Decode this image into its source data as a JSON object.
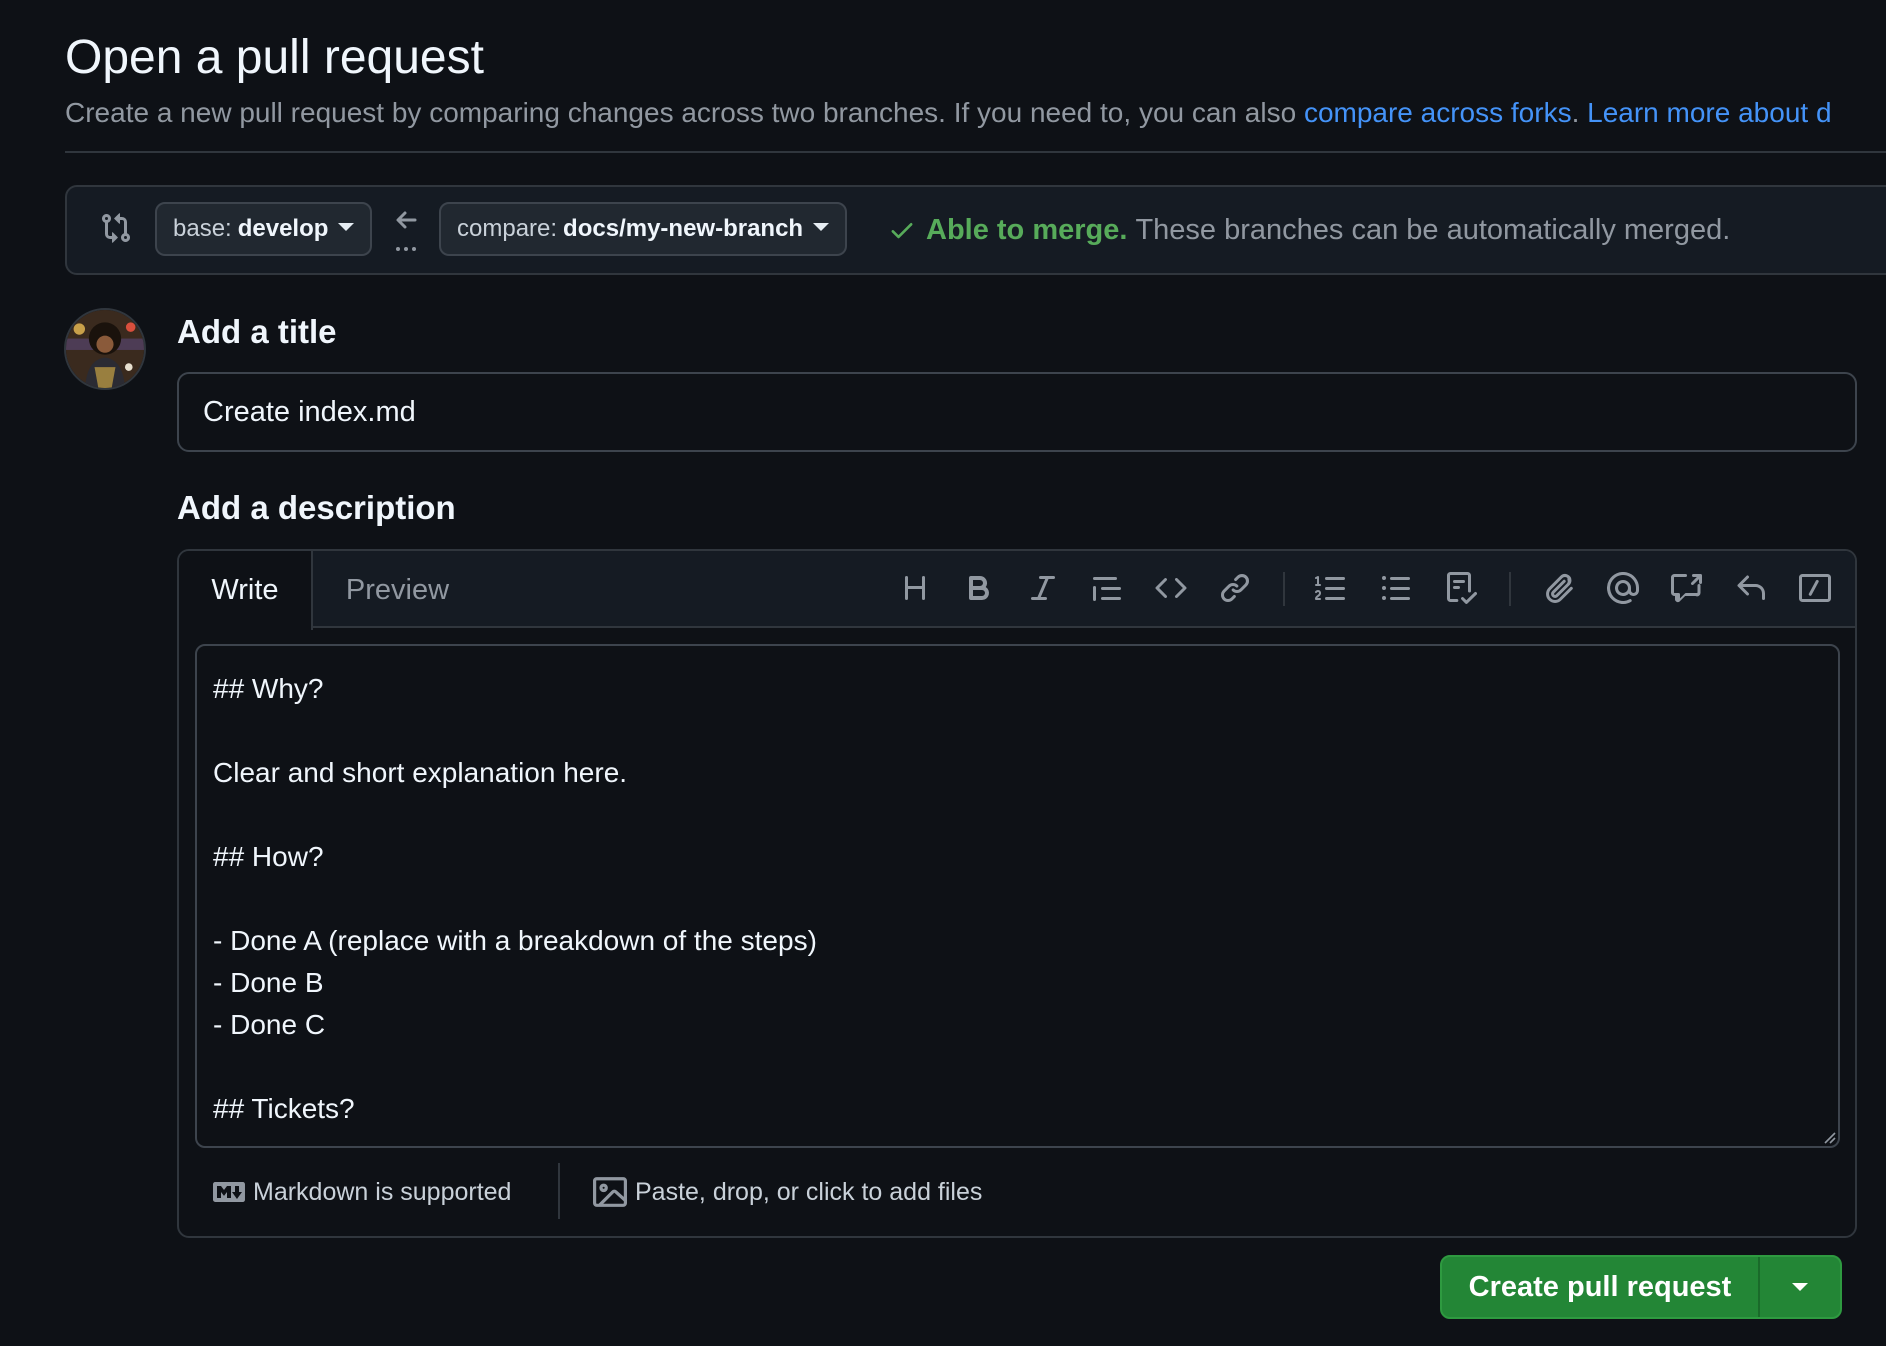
{
  "header": {
    "title": "Open a pull request",
    "subtitle": "Create a new pull request by comparing changes across two branches. If you need to, you can also ",
    "link_forks": "compare across forks",
    "link_sep": ". ",
    "link_learn": "Learn more about d"
  },
  "compare": {
    "base_prefix": "base:",
    "base_branch": "develop",
    "compare_prefix": "compare:",
    "compare_branch": "docs/my-new-branch",
    "merge_ok": "Able to merge.",
    "merge_desc": "These branches can be automatically merged."
  },
  "form": {
    "title_label": "Add a title",
    "title_value": "Create index.md",
    "description_label": "Add a description",
    "tabs": {
      "write": "Write",
      "preview": "Preview"
    },
    "body": "## Why?\n\nClear and short explanation here.\n\n## How?\n\n- Done A (replace with a breakdown of the steps)\n- Done B\n- Done C\n\n## Tickets?",
    "markdown_note": "Markdown is supported",
    "attach_note": "Paste, drop, or click to add files"
  },
  "toolbar": {
    "icons": [
      "heading-icon",
      "bold-icon",
      "italic-icon",
      "quote-icon",
      "code-icon",
      "link-icon",
      "ordered-list-icon",
      "unordered-list-icon",
      "task-list-icon",
      "attach-icon",
      "mention-icon",
      "reference-icon",
      "reply-icon",
      "slash-command-icon"
    ]
  },
  "actions": {
    "create_label": "Create pull request"
  },
  "colors": {
    "background": "#0e1116",
    "link": "#4493f8",
    "success": "#57ab5a",
    "primary_button": "#238636"
  }
}
